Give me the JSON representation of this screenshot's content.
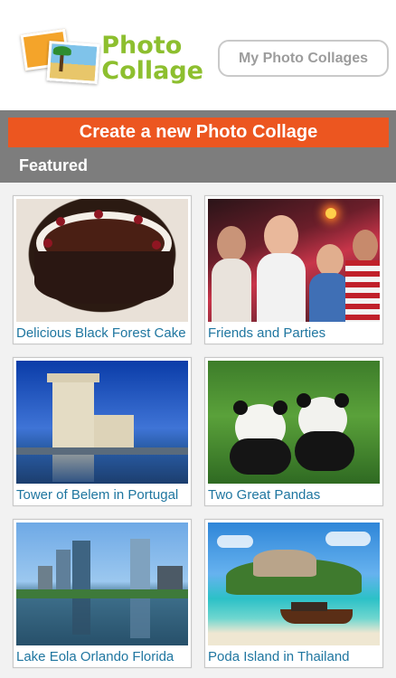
{
  "header": {
    "logo_line1": "Photo",
    "logo_line2": "Collage",
    "my_collages_label": "My Photo Collages"
  },
  "create_button_label": "Create a new Photo Collage",
  "featured_label": "Featured",
  "cards": [
    {
      "caption": "Delicious Black Forest Cake"
    },
    {
      "caption": "Friends and Parties"
    },
    {
      "caption": "Tower of Belem in Portugal"
    },
    {
      "caption": "Two Great Pandas"
    },
    {
      "caption": "Lake Eola Orlando Florida"
    },
    {
      "caption": "Poda Island in Thailand"
    }
  ],
  "colors": {
    "accent_orange": "#ec5620",
    "bar_grey": "#7d7d7d",
    "caption_blue": "#1f76a0",
    "logo_green": "#8dbf2f"
  }
}
